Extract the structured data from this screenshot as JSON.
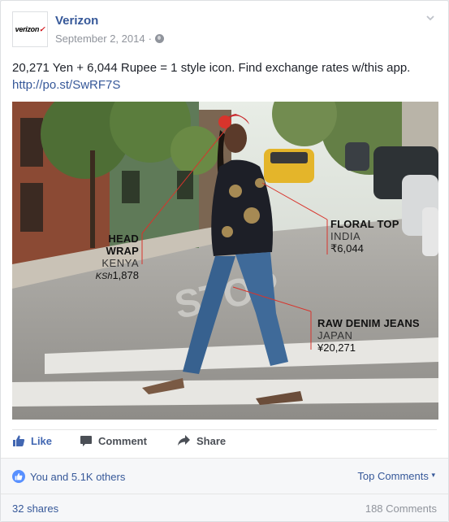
{
  "post": {
    "page_name": "Verizon",
    "avatar_logo": "verizon",
    "avatar_check": "✓",
    "date": "September 2, 2014",
    "privacy_separator": "·",
    "message": "20,271 Yen + 6,044 Rupee = 1 style icon. Find exchange rates w/this app.",
    "link": "http://po.st/SwRF7S"
  },
  "photo_tags": [
    {
      "title": "HEAD WRAP",
      "country": "KENYA",
      "currency": "KSh",
      "amount": "1,878"
    },
    {
      "title": "FLORAL TOP",
      "country": "INDIA",
      "currency": "₹",
      "amount": "6,044"
    },
    {
      "title": "RAW DENIM JEANS",
      "country": "JAPAN",
      "currency": "¥",
      "amount": "20,271"
    }
  ],
  "actions": {
    "like": "Like",
    "comment": "Comment",
    "share": "Share"
  },
  "reactions": {
    "likes_text": "You and 5.1K others",
    "sort_label": "Top Comments",
    "sort_arrow": "▾"
  },
  "stats": {
    "shares": "32 shares",
    "comments": "188 Comments"
  },
  "colors": {
    "link": "#365899",
    "like_active": "#4267b2",
    "tag_line": "#d8342c"
  },
  "icons": [
    "globe-icon",
    "chevron-down-icon",
    "thumbs-up-icon",
    "comment-icon",
    "share-icon"
  ]
}
